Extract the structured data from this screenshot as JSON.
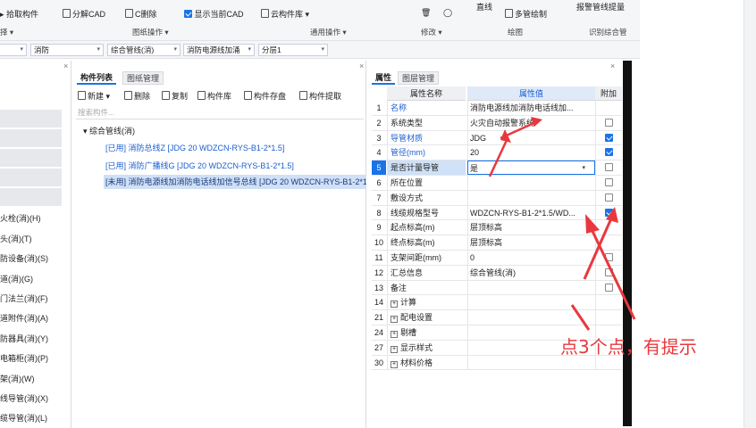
{
  "ribbon": {
    "pick_component": "拾取构件",
    "explode_cad": "分解CAD",
    "c_delete": "C删除",
    "show_current_cad": "显示当前CAD",
    "cloud_library": "云构件库",
    "group_drawing_ops": "图纸操作",
    "group_common_ops": "通用操作",
    "select_fragment": "择",
    "straight_line": "直线",
    "multi_pipe_draw": "多管绘制",
    "group_modify": "修改",
    "group_draw": "绘图",
    "alarm_pipe_extract": "报警管线提量",
    "group_identify": "识别综合管"
  },
  "filter": {
    "discipline": "消防",
    "category": "综合管线(消)",
    "component": "消防电源线加涌",
    "layer": "分层1"
  },
  "left_panel": {
    "items": [
      "火栓(消)(H)",
      "头(消)(T)",
      "防设备(消)(S)",
      "道(消)(G)",
      "门法兰(消)(F)",
      "道附件(消)(A)",
      "防器具(消)(Y)",
      "电箱柜(消)(P)",
      "架(消)(W)",
      "线导管(消)(X)",
      "缆导管(消)(L)"
    ]
  },
  "component_list": {
    "tab_active": "构件列表",
    "tab_other": "图纸管理",
    "toolbar": {
      "new": "新建",
      "delete": "删除",
      "copy": "复制",
      "library": "构件库",
      "save": "构件存盘",
      "extract": "构件提取"
    },
    "search_placeholder": "搜索构件...",
    "tree_root": "综合管线(消)",
    "items": [
      "[已用] 消防总线Z [JDG 20 WDZCN-RYS-B1-2*1.5]",
      "[已用] 消防广播线G [JDG 20 WDZCN-RYS-B1-2*1.5]",
      "[未用] 消防电源线加消防电话线加信号总线 [JDG 20 WDZCN-RYS-B1-2*1.5]"
    ]
  },
  "properties": {
    "tab_active": "属性",
    "tab_other": "图层管理",
    "headers": {
      "name": "属性名称",
      "value": "属性值",
      "extra": "附加"
    },
    "rows": [
      {
        "num": "1",
        "name": "名称",
        "value": "消防电源线加消防电话线加..."
      },
      {
        "num": "2",
        "name": "系统类型",
        "value": "火灾自动报警系统"
      },
      {
        "num": "3",
        "name": "导管材质",
        "value": "JDG"
      },
      {
        "num": "4",
        "name": "管径(mm)",
        "value": "20"
      },
      {
        "num": "5",
        "name": "是否计量导管",
        "value": "是"
      },
      {
        "num": "6",
        "name": "所在位置",
        "value": ""
      },
      {
        "num": "7",
        "name": "敷设方式",
        "value": ""
      },
      {
        "num": "8",
        "name": "线缆规格型号",
        "value": "WDZCN-RYS-B1-2*1.5/WD..."
      },
      {
        "num": "9",
        "name": "起点标高(m)",
        "value": "层顶标高"
      },
      {
        "num": "10",
        "name": "终点标高(m)",
        "value": "层顶标高"
      },
      {
        "num": "11",
        "name": "支架间距(mm)",
        "value": "0"
      },
      {
        "num": "12",
        "name": "汇总信息",
        "value": "综合管线(消)"
      },
      {
        "num": "13",
        "name": "备注",
        "value": ""
      },
      {
        "num": "14",
        "name": "计算",
        "value": ""
      },
      {
        "num": "21",
        "name": "配电设置",
        "value": ""
      },
      {
        "num": "24",
        "name": "剔槽",
        "value": ""
      },
      {
        "num": "27",
        "name": "显示样式",
        "value": ""
      },
      {
        "num": "30",
        "name": "材料价格",
        "value": ""
      }
    ]
  },
  "annotation": {
    "text": "点3个点，有提示",
    "color": "#e03030"
  },
  "colors": {
    "accent": "#1a73e8",
    "selected_row": "#cfe0f7",
    "blue_text": "#1b5fd1"
  }
}
